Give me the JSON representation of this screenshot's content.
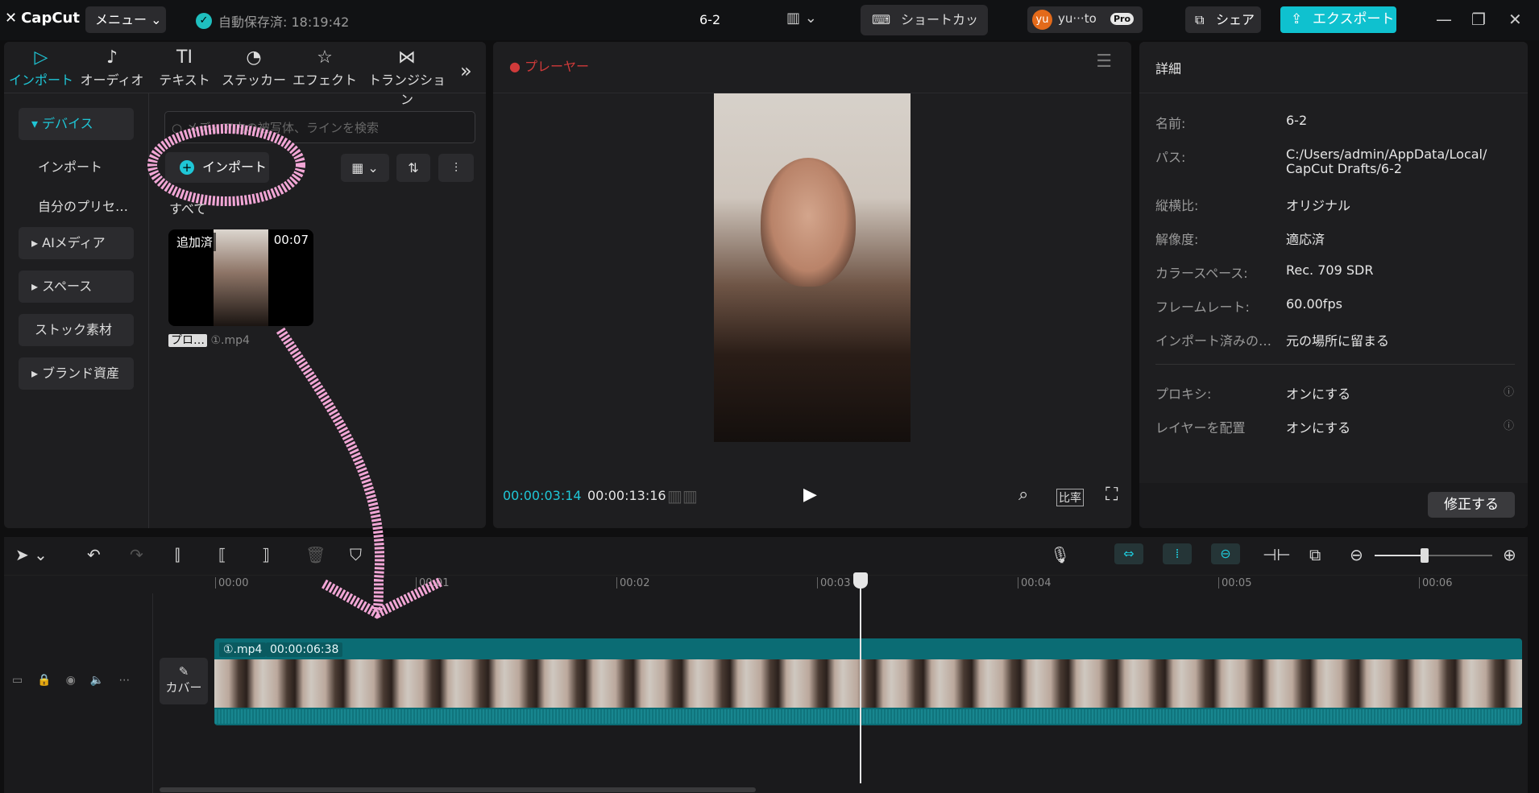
{
  "app": {
    "logo": "CapCut",
    "menu": "メニュー",
    "autosave": "自動保存済: 18:19:42",
    "project_title": "6-2",
    "shortcut": "ショートカット",
    "user_name": "yu···to",
    "user_initials": "yu",
    "pro": "Pro",
    "share": "シェア",
    "export": "エクスポート"
  },
  "media": {
    "tabs": [
      {
        "label": "インポート",
        "icon": "▷"
      },
      {
        "label": "オーディオ",
        "icon": "♪"
      },
      {
        "label": "テキスト",
        "icon": "TI"
      },
      {
        "label": "ステッカー",
        "icon": "◔"
      },
      {
        "label": "エフェクト",
        "icon": "☆"
      },
      {
        "label": "トランジション",
        "icon": "⋈"
      }
    ],
    "sidebar": {
      "device": "デバイス",
      "import": "インポート",
      "presets": "自分のプリセ…",
      "ai_media": "AIメディア",
      "space": "スペース",
      "stock": "ストック素材",
      "brand": "ブランド資産"
    },
    "search_placeholder": "メディア内の被写体、ラインを検索",
    "import_button": "インポート",
    "all_label": "すべて",
    "thumb": {
      "badge": "追加済",
      "duration": "00:07",
      "tag": "プロ…",
      "name": "①.mp4"
    }
  },
  "player": {
    "title": "プレーヤー",
    "current": "00:00:03:14",
    "total": "00:00:13:16",
    "ratio": "比率"
  },
  "details": {
    "title": "詳細",
    "rows": [
      {
        "label": "名前:",
        "value": "6-2"
      },
      {
        "label": "パス:",
        "value": "C:/Users/admin/AppData/Local/"
      },
      {
        "label": "縦横比:",
        "value": "オリジナル"
      },
      {
        "label": "解像度:",
        "value": "適応済"
      },
      {
        "label": "カラースペース:",
        "value": "Rec. 709 SDR"
      },
      {
        "label": "フレームレート:",
        "value": "60.00fps"
      },
      {
        "label": "インポート済みの…",
        "value": "元の場所に留まる"
      }
    ],
    "path_line2": "CapCut Drafts/6-2",
    "proxy_label": "プロキシ:",
    "proxy_value": "オンにする",
    "layer_label": "レイヤーを配置",
    "layer_value": "オンにする",
    "fix_button": "修正する"
  },
  "timeline": {
    "ticks": [
      "00:00",
      "00:01",
      "00:02",
      "00:03",
      "00:04",
      "00:05",
      "00:06"
    ],
    "clip_name": "①.mp4",
    "clip_duration": "00:00:06:38",
    "cover": "カバー"
  },
  "colors": {
    "accent": "#1fc6d6",
    "export": "#0fc1cf",
    "clip": "#0b6c74",
    "recording": "#d03a3a",
    "annotation": "#f2a6d6"
  }
}
